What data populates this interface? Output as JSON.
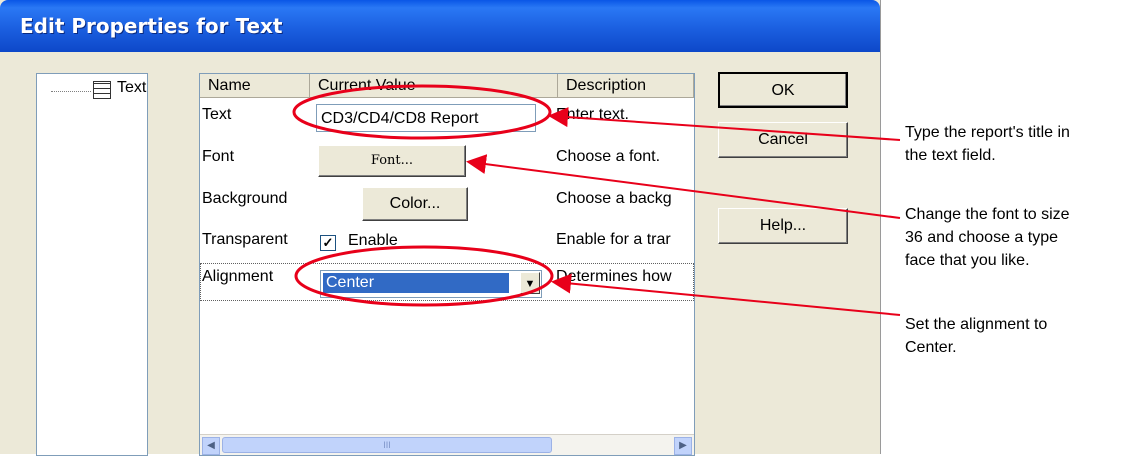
{
  "dialog": {
    "title": "Edit Properties for Text",
    "tree": {
      "item_label": "Text"
    },
    "grid": {
      "headers": [
        "Name",
        "Current Value",
        "Description"
      ],
      "rows": [
        {
          "name": "Text",
          "description": "Enter text."
        },
        {
          "name": "Font",
          "description": "Choose a font."
        },
        {
          "name": "Background",
          "description": "Choose a backg"
        },
        {
          "name": "Transparent",
          "description": "Enable for a trar"
        },
        {
          "name": "Alignment",
          "description": "Determines how"
        }
      ],
      "text_value": "CD3/CD4/CD8 Report",
      "font_button": "Font...",
      "color_button": "Color...",
      "transparent_checkbox": {
        "label": "Enable",
        "checked": true
      },
      "alignment_selected": "Center",
      "scroll_thumb_grip": "III"
    },
    "buttons": {
      "ok": "OK",
      "cancel": "Cancel",
      "help": "Help..."
    }
  },
  "annotations": [
    [
      "Type the report's title in",
      "the text field."
    ],
    [
      "Change the font to size",
      "36 and choose a type",
      "face that you like."
    ],
    [
      "Set the alignment to",
      "Center."
    ]
  ],
  "colors": {
    "titlebar": "#0a56e6",
    "dialog_bg": "#ece9d8",
    "annotation_red": "#e8001a",
    "selection": "#316ac5"
  },
  "icons": [
    "tree-item-icon",
    "checkmark-icon",
    "dropdown-arrow-icon",
    "scroll-left-icon",
    "scroll-right-icon"
  ]
}
